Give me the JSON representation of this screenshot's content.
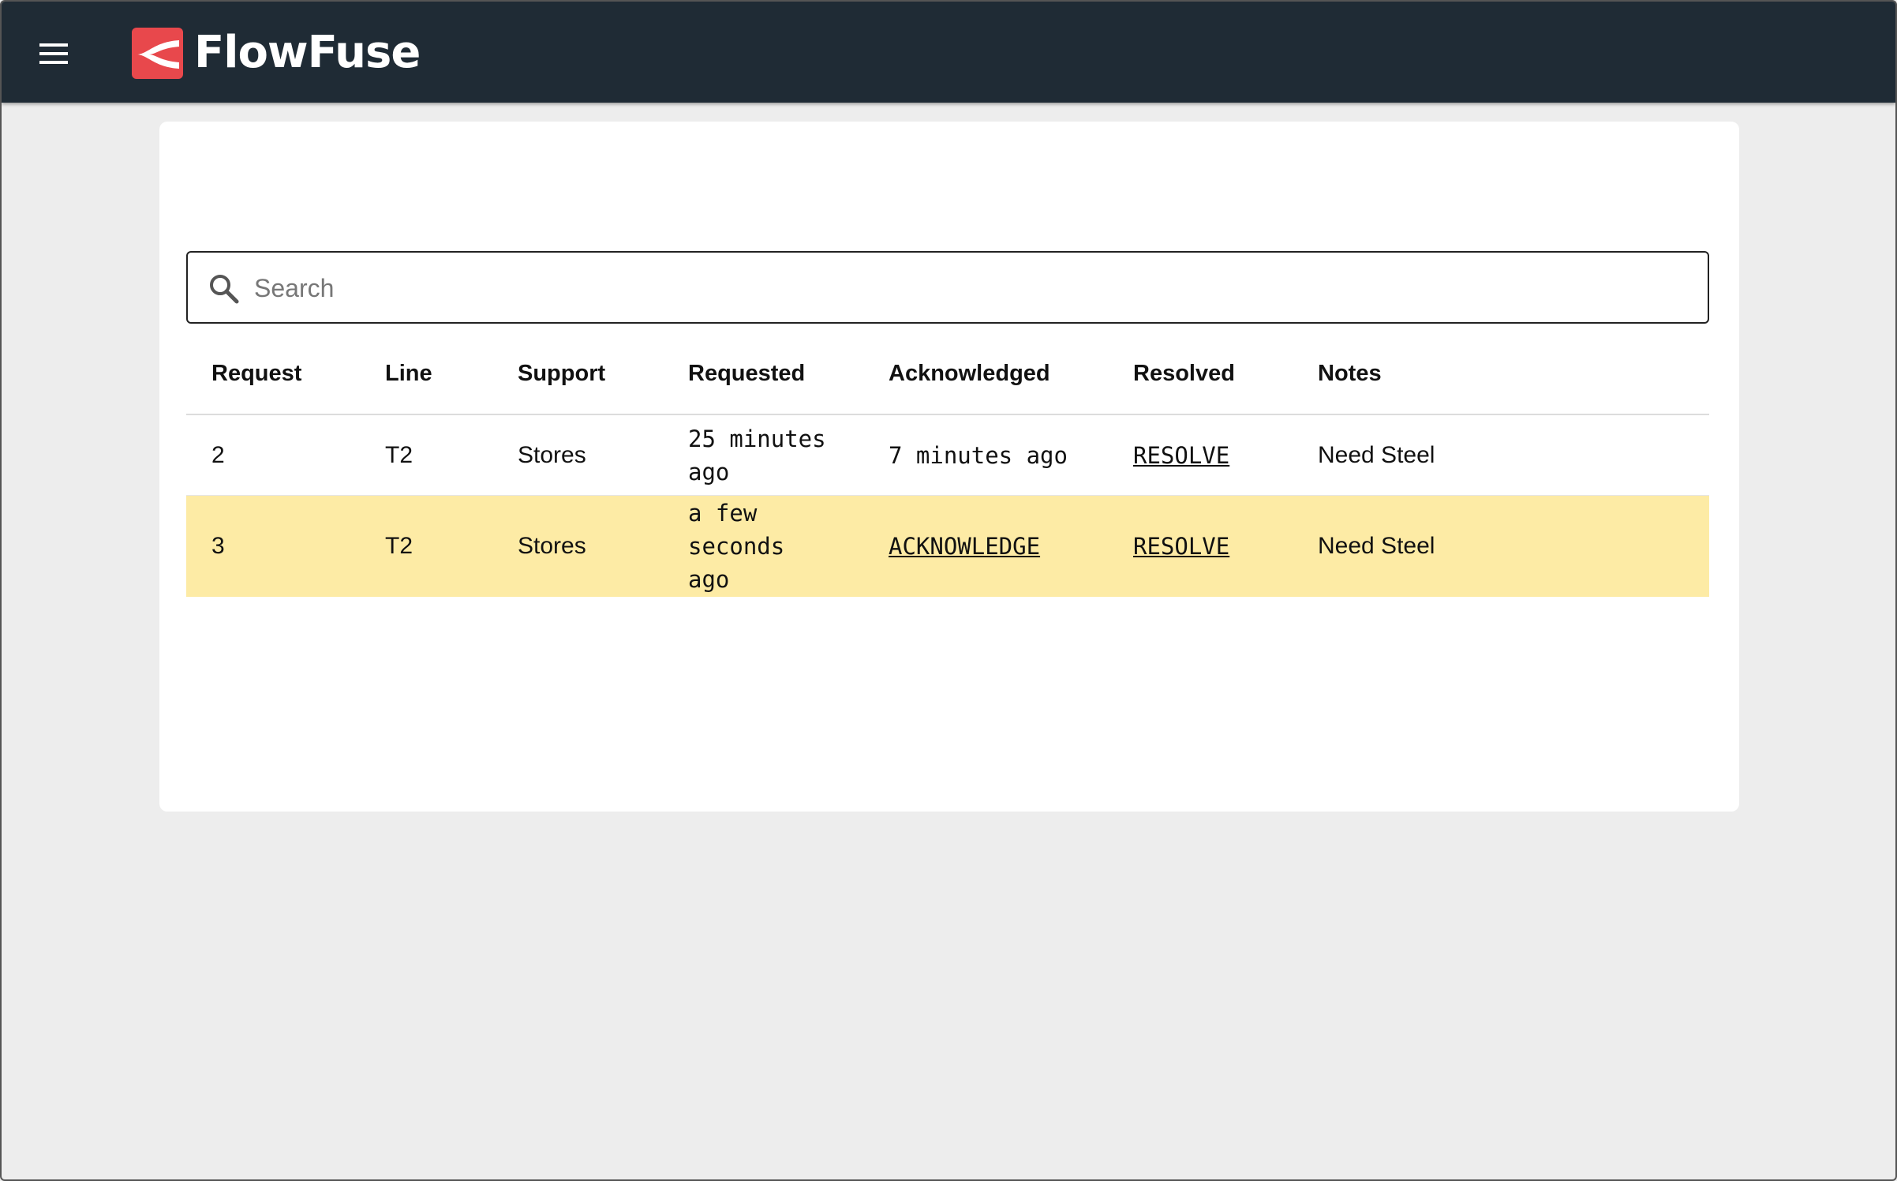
{
  "header": {
    "brand": "FlowFuse",
    "colors": {
      "bar": "#1f2b35",
      "logo": "#e8484c"
    }
  },
  "search": {
    "placeholder": "Search"
  },
  "table": {
    "columns": [
      "Request",
      "Line",
      "Support",
      "Requested",
      "Acknowledged",
      "Resolved",
      "Notes"
    ],
    "rows": [
      {
        "request": "2",
        "line": "T2",
        "support": "Stores",
        "requested": "25 minutes ago",
        "acknowledged": "7 minutes ago",
        "resolved": "RESOLVE",
        "notes": "Need Steel"
      },
      {
        "request": "3",
        "line": "T2",
        "support": "Stores",
        "requested": "a few seconds ago",
        "acknowledged": "ACKNOWLEDGE",
        "resolved": "RESOLVE",
        "notes": "Need Steel",
        "highlight_color": "#fdeba5"
      }
    ]
  }
}
